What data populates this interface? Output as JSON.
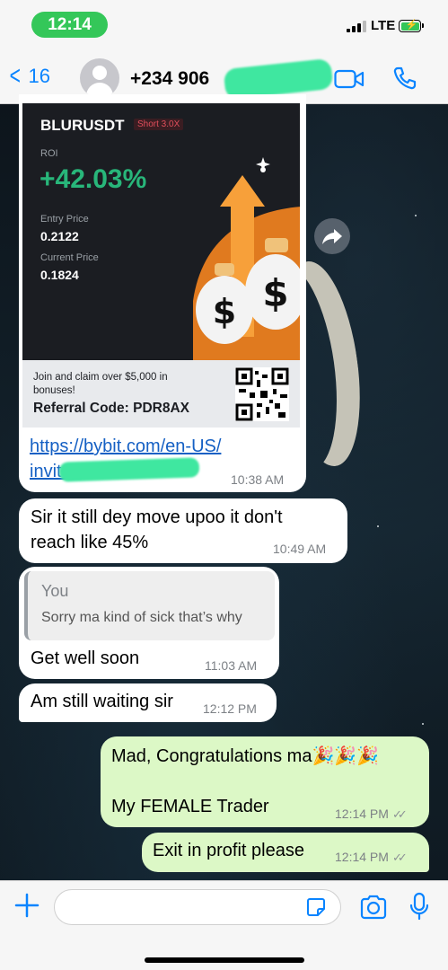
{
  "status_bar": {
    "time": "12:14",
    "network": "LTE"
  },
  "nav": {
    "back_count": "16",
    "contact": "+234 906"
  },
  "card": {
    "pair": "BLURUSDT",
    "tag": "Short 3.0X",
    "roi_label": "ROI",
    "roi_value": "+42.03%",
    "entry_label": "Entry Price",
    "entry_value": "0.2122",
    "current_label": "Current Price",
    "current_value": "0.1824",
    "promo_text": "Join and claim over $5,000 in bonuses!",
    "referral": "Referral Code: PDR8AX"
  },
  "messages": [
    {
      "direction": "in",
      "link1": "https://bybit.com/en-US/",
      "link2": "invite?",
      "time": "10:38 AM"
    },
    {
      "direction": "in",
      "line1": "Sir it still dey move upoo it don't",
      "line2": "reach like 45%",
      "time": "10:49 AM"
    },
    {
      "direction": "in",
      "quote_author": "You",
      "quote_text": "Sorry ma kind of sick that’s why",
      "text": "Get well soon",
      "time": "11:03 AM"
    },
    {
      "direction": "in",
      "text": "Am still waiting sir",
      "time": "12:12 PM"
    },
    {
      "direction": "out",
      "line1": "Mad, Congratulations ma🎉🎉🎉",
      "line2": "My FEMALE Trader",
      "time": "12:14 PM"
    },
    {
      "direction": "out",
      "text": "Exit in profit please",
      "time": "12:14 PM"
    }
  ],
  "input": {
    "placeholder": ""
  },
  "colors": {
    "ios_blue": "#0a84ff",
    "outgoing_bubble": "#dcf8c6",
    "roi_green": "#28b67a",
    "time_pill": "#34c759"
  }
}
